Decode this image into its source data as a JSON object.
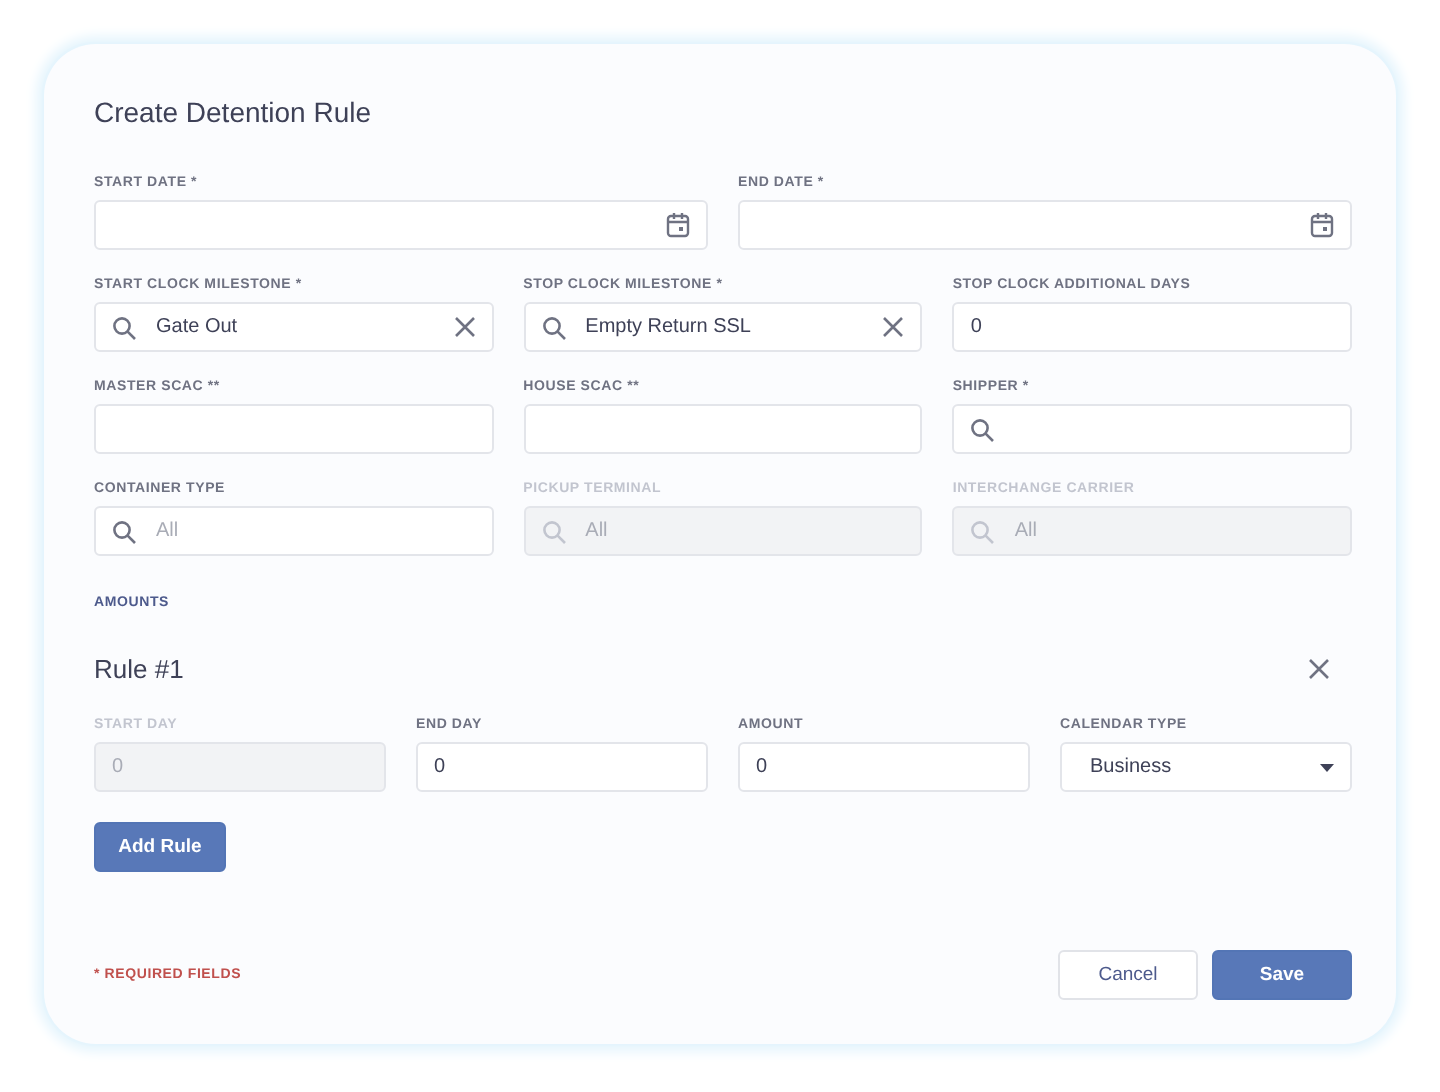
{
  "title": "Create Detention Rule",
  "field_rows": [
    [
      {
        "label": "START DATE *",
        "kind": "date",
        "disabled": false
      },
      {
        "label": "END DATE *",
        "kind": "date",
        "disabled": false
      }
    ],
    [
      {
        "label": "START CLOCK MILESTONE *",
        "kind": "search",
        "value": "Gate Out",
        "clearable": true,
        "disabled": false
      },
      {
        "label": "STOP CLOCK MILESTONE *",
        "kind": "search",
        "value": "Empty Return SSL",
        "clearable": true,
        "disabled": false
      },
      {
        "label": "STOP CLOCK ADDITIONAL DAYS",
        "kind": "text",
        "value": "0",
        "disabled": false
      }
    ],
    [
      {
        "label": "MASTER SCAC **",
        "kind": "text",
        "disabled": false
      },
      {
        "label": "HOUSE SCAC **",
        "kind": "text",
        "disabled": false
      },
      {
        "label": "SHIPPER *",
        "kind": "search",
        "clearable": false,
        "disabled": false
      }
    ],
    [
      {
        "label": "CONTAINER TYPE",
        "kind": "search",
        "placeholder": "All",
        "clearable": false,
        "disabled": false
      },
      {
        "label": "PICKUP TERMINAL",
        "kind": "search",
        "placeholder": "All",
        "clearable": false,
        "disabled": true
      },
      {
        "label": "INTERCHANGE CARRIER",
        "kind": "search",
        "placeholder": "All",
        "clearable": false,
        "disabled": true
      }
    ]
  ],
  "amounts_label": "AMOUNTS",
  "rules": [
    {
      "title": "Rule #1",
      "fields": [
        {
          "label": "START DAY",
          "kind": "text",
          "placeholder": "0",
          "disabled": true
        },
        {
          "label": "END DAY",
          "kind": "text",
          "value": "0",
          "disabled": false
        },
        {
          "label": "AMOUNT",
          "kind": "text",
          "value": "0",
          "disabled": false
        },
        {
          "label": "CALENDAR TYPE",
          "kind": "select",
          "value": "Business",
          "disabled": false
        }
      ]
    }
  ],
  "add_rule_button": "Add Rule",
  "required_note": "* REQUIRED FIELDS",
  "buttons": [
    {
      "label": "Cancel",
      "kind": "secondary"
    },
    {
      "label": "Save",
      "kind": "primary"
    }
  ]
}
